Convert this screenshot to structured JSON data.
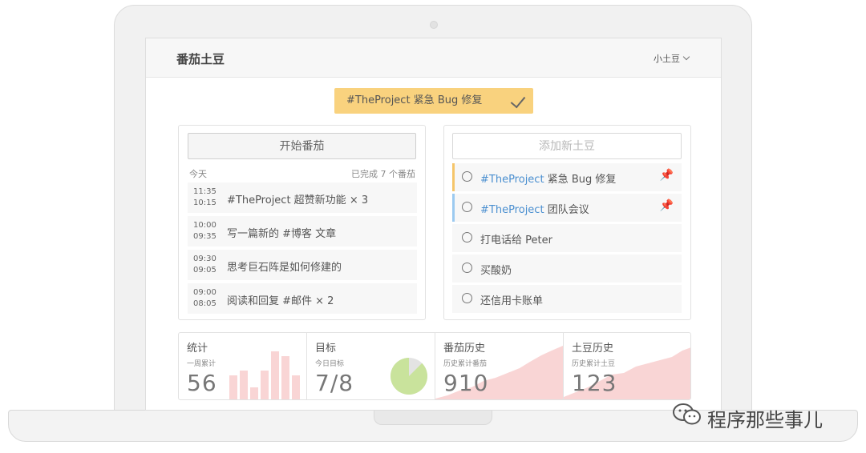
{
  "app": {
    "title": "番茄土豆",
    "user": "小土豆"
  },
  "current_task": {
    "label": "#TheProject 紧急 Bug 修复"
  },
  "pomodoro_panel": {
    "start_label": "开始番茄",
    "today_label": "今天",
    "completed_label": "已完成 7 个番茄",
    "history": [
      {
        "end": "11:35",
        "start": "10:15",
        "text": "#TheProject 超赞新功能  × 3"
      },
      {
        "end": "10:00",
        "start": "09:35",
        "text": "写一篇新的 #博客 文章"
      },
      {
        "end": "09:30",
        "start": "09:05",
        "text": "思考巨石阵是如何修建的"
      },
      {
        "end": "09:00",
        "start": "08:05",
        "text": "阅读和回复 #邮件  × 2"
      }
    ]
  },
  "todo_panel": {
    "add_placeholder": "添加新土豆",
    "items": [
      {
        "tag": "#TheProject",
        "text": " 紧急 Bug 修复",
        "pinned": true,
        "bar": "yellow"
      },
      {
        "tag": "#TheProject",
        "text": " 团队会议",
        "pinned": true,
        "bar": "blue"
      },
      {
        "tag": "",
        "text": "打电话给 Peter",
        "pinned": false,
        "bar": ""
      },
      {
        "tag": "",
        "text": "买酸奶",
        "pinned": false,
        "bar": ""
      },
      {
        "tag": "",
        "text": "还信用卡账单",
        "pinned": false,
        "bar": ""
      }
    ]
  },
  "stats": {
    "weekly": {
      "title": "统计",
      "sub": "一周累计",
      "value": "56",
      "bars": [
        10,
        12,
        5,
        12,
        20,
        18,
        10
      ]
    },
    "goal": {
      "title": "目标",
      "sub": "今日目标",
      "value": "7/8",
      "done": 7,
      "total": 8
    },
    "pomodoro_history": {
      "title": "番茄历史",
      "sub": "历史累计番茄",
      "value": "910"
    },
    "potato_history": {
      "title": "土豆历史",
      "sub": "历史累计土豆",
      "value": "123"
    }
  },
  "colors": {
    "current_task_bg": "#f9d27e",
    "tag_blue": "#4a8fd0",
    "pin_red": "#e8545d",
    "bar_yellow": "#f5c56a",
    "bar_blue": "#9ccaf0",
    "chart_pink": "#f9d5d5",
    "pie_green": "#c9e39c",
    "pie_grey": "#e3e3e3"
  },
  "watermark": {
    "text": "程序那些事儿"
  }
}
